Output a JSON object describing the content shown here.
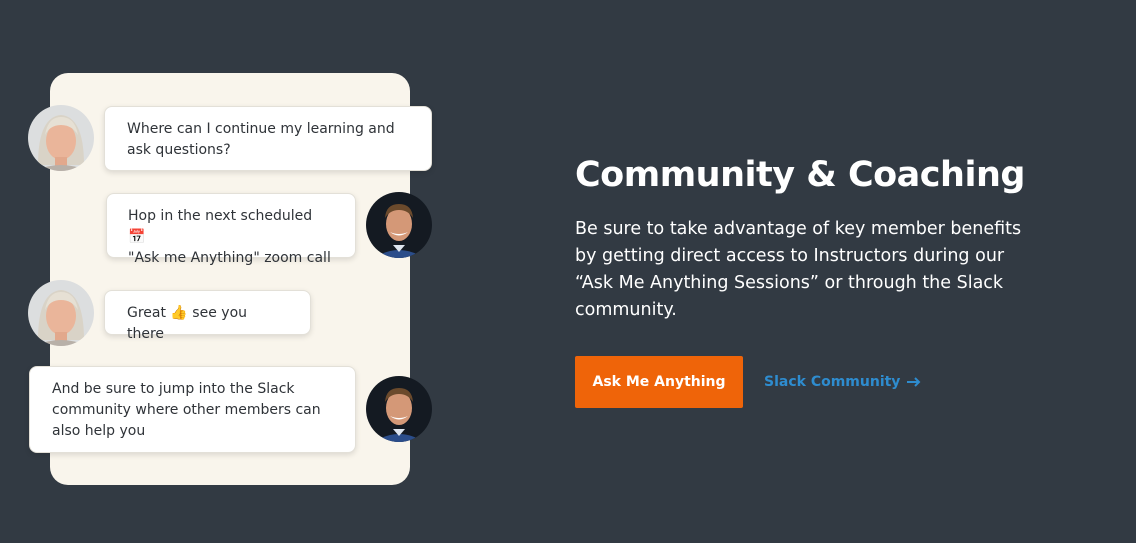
{
  "chat": {
    "messages": [
      {
        "sender": "member",
        "text": "Where can I continue my learning and\nask questions?"
      },
      {
        "sender": "instructor",
        "text": "Hop in the next scheduled 📅\n\"Ask me Anything\" zoom call"
      },
      {
        "sender": "member",
        "text": "Great 👍 see you there"
      },
      {
        "sender": "instructor",
        "text": "And be sure to jump into the Slack\ncommunity where other members can\nalso help you"
      }
    ]
  },
  "section": {
    "title": "Community & Coaching",
    "description": "Be sure to take advantage of key member benefits by getting direct access to Instructors during our “Ask Me Anything Sessions” or through the Slack community.",
    "primary_button": "Ask Me Anything",
    "secondary_link": "Slack Community"
  },
  "colors": {
    "background": "#323a43",
    "chat_panel": "#f9f5ec",
    "accent": "#ef6409",
    "link": "#2e8ccf"
  },
  "icons": {
    "member_avatar": "woman-avatar",
    "instructor_avatar": "man-avatar",
    "link_arrow": "arrow-right-icon"
  }
}
